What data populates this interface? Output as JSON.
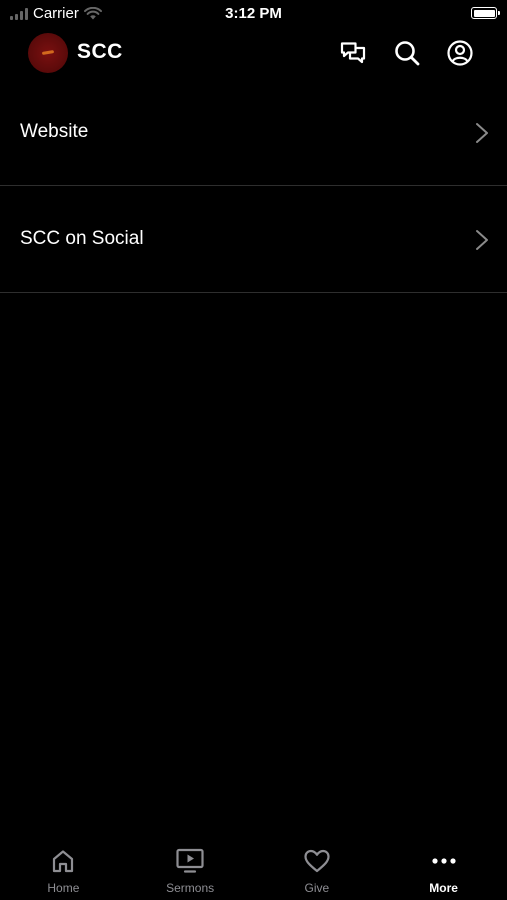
{
  "status_bar": {
    "carrier": "Carrier",
    "time": "3:12 PM"
  },
  "header": {
    "title": "SCC",
    "logo_icon": "scc-logo",
    "actions": [
      {
        "icon": "chat-icon"
      },
      {
        "icon": "search-icon"
      },
      {
        "icon": "profile-icon"
      }
    ]
  },
  "menu": {
    "items": [
      {
        "label": "Website",
        "icon": "chevron-right-icon"
      },
      {
        "label": "SCC on Social",
        "icon": "chevron-right-icon"
      }
    ]
  },
  "tab_bar": {
    "tabs": [
      {
        "label": "Home",
        "icon": "home-icon",
        "active": false
      },
      {
        "label": "Sermons",
        "icon": "tv-play-icon",
        "active": false
      },
      {
        "label": "Give",
        "icon": "heart-icon",
        "active": false
      },
      {
        "label": "More",
        "icon": "more-dots-icon",
        "active": true
      }
    ]
  },
  "colors": {
    "background": "#000000",
    "text": "#ffffff",
    "inactive_tab": "#8e8e93",
    "divider": "#2e2e2e",
    "logo": "#7a1010"
  }
}
